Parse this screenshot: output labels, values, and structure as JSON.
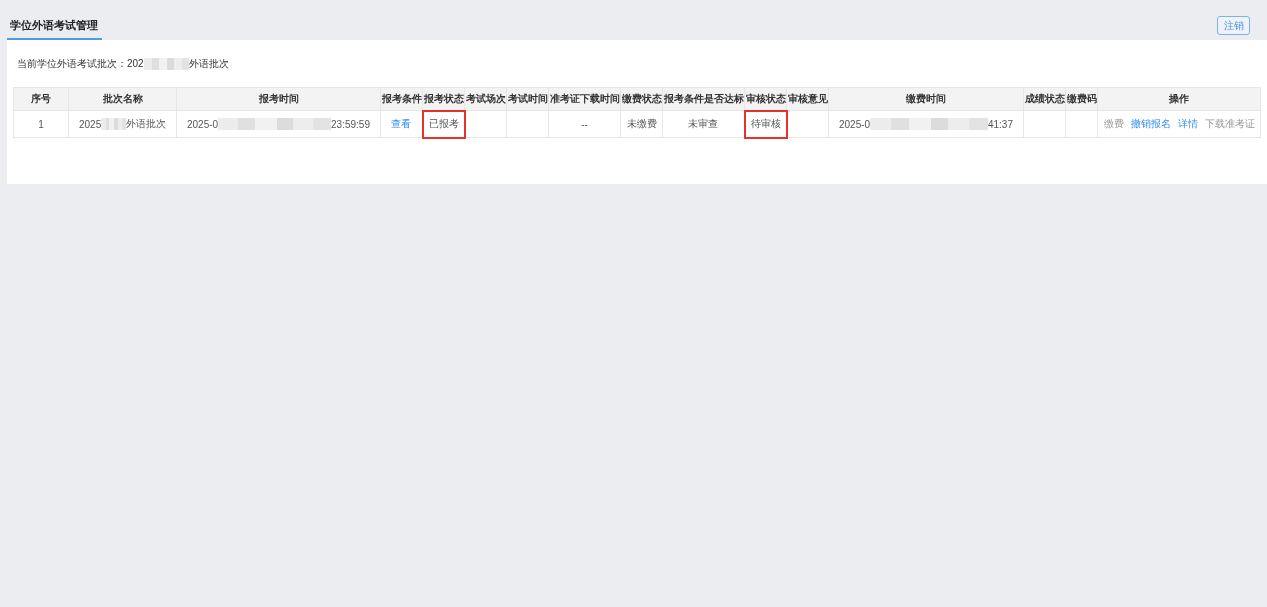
{
  "tabs": [
    {
      "label": "学位外语考试管理",
      "selected": true
    }
  ],
  "header": {
    "logout_button": "注销"
  },
  "batch": {
    "text_before": "当前学位外语考试批次：202",
    "text_after": "外语批次"
  },
  "table": {
    "columns": [
      "序号",
      "批次名称",
      "报考时间",
      "报考条件",
      "报考状态",
      "考试场次",
      "考试时间",
      "准考证下载时间",
      "缴费状态",
      "报考条件是否达标",
      "审核状态",
      "审核意见",
      "缴费时间",
      "成绩状态",
      "缴费码",
      "操作"
    ],
    "rows": [
      {
        "cells": [
          {
            "kind": "text",
            "text": "1",
            "highlighted": false
          },
          {
            "kind": "redacted",
            "prefix": "2025",
            "suffix": "外语批次",
            "highlighted": false
          },
          {
            "kind": "redacted",
            "prefix": "2025-0",
            "suffix": "23:59:59",
            "highlighted": false
          },
          {
            "kind": "link",
            "text": "查看",
            "highlighted": false
          },
          {
            "kind": "text",
            "text": "已报考",
            "highlighted": true
          },
          {
            "kind": "empty",
            "highlighted": false
          },
          {
            "kind": "empty",
            "highlighted": false
          },
          {
            "kind": "text",
            "text": "--",
            "highlighted": false
          },
          {
            "kind": "text",
            "text": "未缴费",
            "highlighted": false
          },
          {
            "kind": "text",
            "text": "未审查",
            "highlighted": false
          },
          {
            "kind": "text",
            "text": "待审核",
            "highlighted": true
          },
          {
            "kind": "empty",
            "highlighted": false
          },
          {
            "kind": "redacted",
            "prefix": "2025-0",
            "suffix": "41:37",
            "highlighted": false
          },
          {
            "kind": "empty",
            "highlighted": false
          },
          {
            "kind": "empty",
            "highlighted": false
          },
          {
            "kind": "actions",
            "highlighted": false,
            "actions": [
              {
                "label": "缴费",
                "disabled": true
              },
              {
                "label": "撤销报名",
                "disabled": false
              },
              {
                "label": "详情",
                "disabled": false
              },
              {
                "label": "下载准考证",
                "disabled": true
              }
            ]
          }
        ]
      }
    ]
  }
}
